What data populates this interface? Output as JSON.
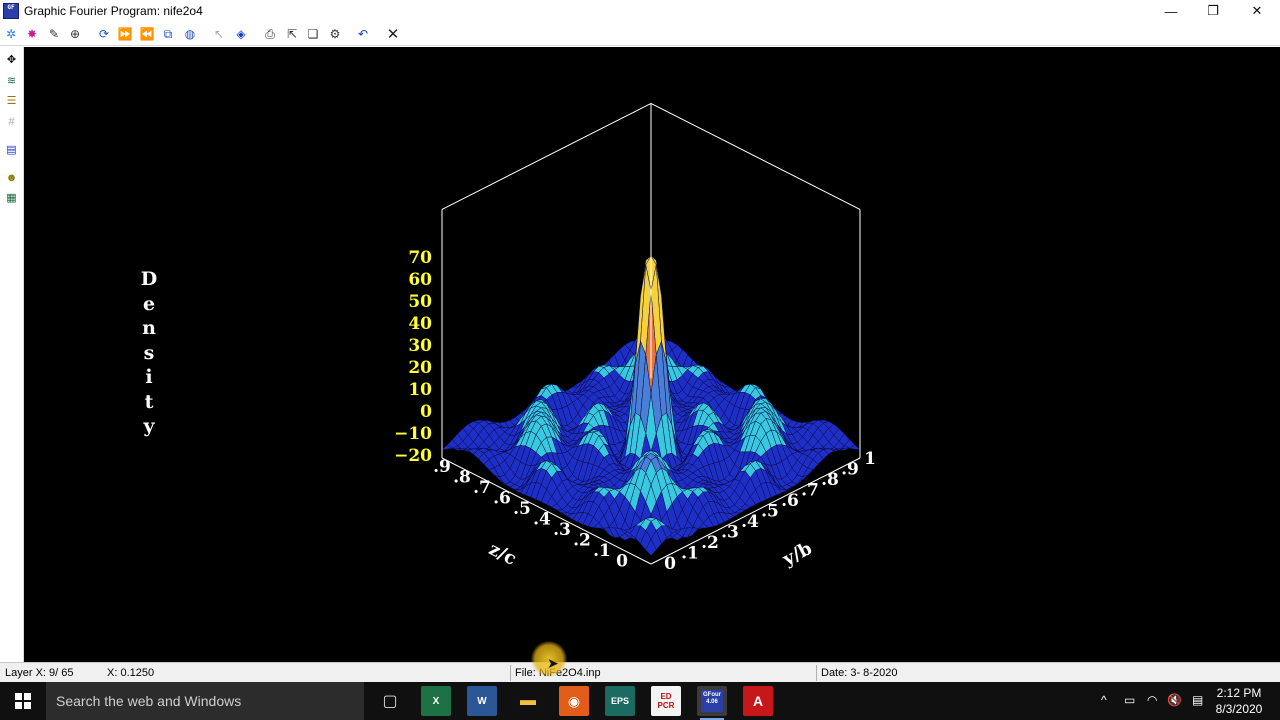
{
  "window": {
    "title": "Graphic Fourier Program: nife2o4",
    "app_icon": "GF\n4.06",
    "controls": {
      "minimize": "—",
      "restore": "❐",
      "close": "✕"
    }
  },
  "toolbar": {
    "icons": [
      "select-all-icon",
      "color-burst-icon",
      "pen-icon",
      "crosshair-icon",
      "rotate-icon",
      "fast-forward-icon",
      "rewind-icon",
      "layers-icon",
      "palette-icon",
      "pointer-icon",
      "move-diamond-icon",
      "print-icon",
      "export-icon",
      "copy-image-icon",
      "settings-icon",
      "undo-icon",
      "close-icon"
    ],
    "undo": "↶",
    "close": "✕"
  },
  "sidebar": {
    "icons": [
      "move-icon",
      "contour-icon",
      "list-icon",
      "grid-icon",
      "chart-icon",
      "smiley-icon",
      "map-icon"
    ]
  },
  "plot": {
    "vertical_label": [
      "D",
      "e",
      "n",
      "s",
      "i",
      "t",
      "y"
    ],
    "z_axis_ticks": [
      "70",
      "60",
      "50",
      "40",
      "30",
      "20",
      "10",
      "0",
      "−10",
      "−20"
    ],
    "left_axis_ticks": [
      ".9",
      ".8",
      ".7",
      ".6",
      ".5",
      ".4",
      ".3",
      ".2",
      ".1",
      "0"
    ],
    "right_axis_ticks": [
      "0",
      ".1",
      ".2",
      ".3",
      ".4",
      ".5",
      ".6",
      ".7",
      ".8",
      ".9",
      "1"
    ],
    "left_axis_label": "z/c",
    "right_axis_label": "y/b",
    "colors": {
      "background": "#000000",
      "frame": "#ffffff",
      "tick": "#ffff33",
      "deep": "#1e2fc8",
      "low": "#38c8e0",
      "mid": "#4a7fd8",
      "high": "#e8783a",
      "peak": "#f6d23a"
    }
  },
  "status": {
    "layer": "Layer X:  9/ 65",
    "x_value": "X:  0.1250",
    "file": "File: NiFe2O4.inp",
    "date": "Date:  3- 8-2020"
  },
  "taskbar": {
    "search_placeholder": "Search the web and Windows",
    "apps": [
      {
        "name": "task-view-icon",
        "label": "▢"
      },
      {
        "name": "excel-icon",
        "label": "X"
      },
      {
        "name": "word-icon",
        "label": "W"
      },
      {
        "name": "file-explorer-icon",
        "label": "▬"
      },
      {
        "name": "orange-app-icon",
        "label": "◉"
      },
      {
        "name": "eps-toolkit-icon",
        "label": "EPS"
      },
      {
        "name": "ed-pcr-icon",
        "label": "ED PCR"
      },
      {
        "name": "gfour-icon",
        "label": "GFour 4.06"
      },
      {
        "name": "acrobat-icon",
        "label": "A"
      }
    ],
    "tray": {
      "chevron": "^",
      "battery": "▭",
      "wifi": "◠",
      "volume": "🔇",
      "notifications": "▤"
    },
    "time": "2:12 PM",
    "date": "8/3/2020"
  }
}
